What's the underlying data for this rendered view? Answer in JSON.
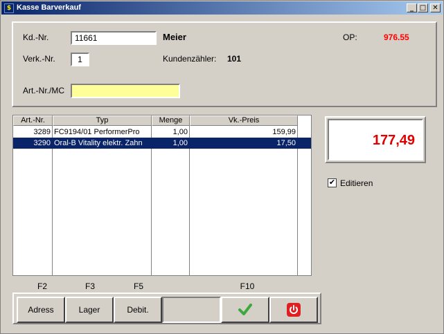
{
  "window": {
    "title": "Kasse Barverkauf",
    "app_icon": "$",
    "minimize": "_",
    "maximize": "□",
    "close": "✕"
  },
  "customer": {
    "kd_label": "Kd.-Nr.",
    "kd_value": "11661",
    "name": "Meier",
    "op_label": "OP:",
    "op_value": "976.55",
    "verk_label": "Verk.-Nr.",
    "verk_value": "1",
    "counter_label": "Kundenzähler:",
    "counter_value": "101",
    "art_label": "Art.-Nr./MC",
    "art_value": ""
  },
  "table": {
    "headers": [
      "Art.-Nr.",
      "Typ",
      "Menge",
      "Vk.-Preis"
    ],
    "rows": [
      {
        "art": "3289",
        "typ": "FC9194/01 PerformerPro",
        "menge": "1,00",
        "preis": "159,99",
        "selected": false
      },
      {
        "art": "3290",
        "typ": "Oral-B Vitality elektr. Zahn",
        "menge": "1,00",
        "preis": "17,50",
        "selected": true
      }
    ]
  },
  "total": "177,49",
  "edit_checkbox": {
    "label": "Editieren",
    "checked": true
  },
  "fkeys": {
    "f2": "F2",
    "f3": "F3",
    "f5": "F5",
    "f10": "F10"
  },
  "buttons": {
    "adress": "Adress",
    "lager": "Lager",
    "debit": "Debit."
  },
  "colors": {
    "op": "#ff0000",
    "total": "#e00000",
    "art_field": "#ffff99",
    "selection": "#0a246a"
  }
}
